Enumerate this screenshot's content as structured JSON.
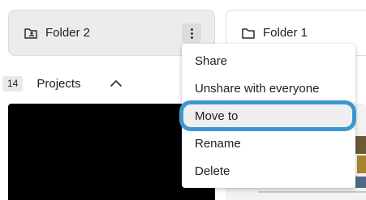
{
  "folders": [
    {
      "name": "Folder 2",
      "icon": "shared-folder-icon"
    },
    {
      "name": "Folder 1",
      "icon": "folder-icon"
    }
  ],
  "section": {
    "count": "14",
    "title": "Projects",
    "collapse_icon": "chevron-up-icon"
  },
  "context_menu": {
    "items": [
      {
        "label": "Share"
      },
      {
        "label": "Unshare with everyone"
      },
      {
        "label": "Move to"
      },
      {
        "label": "Rename"
      },
      {
        "label": "Delete"
      }
    ],
    "highlighted_index": 2
  },
  "colors": {
    "highlight_ring": "#3d96cf",
    "selected_card_bg": "#ececec",
    "menu_hover_bg": "#efefef"
  }
}
